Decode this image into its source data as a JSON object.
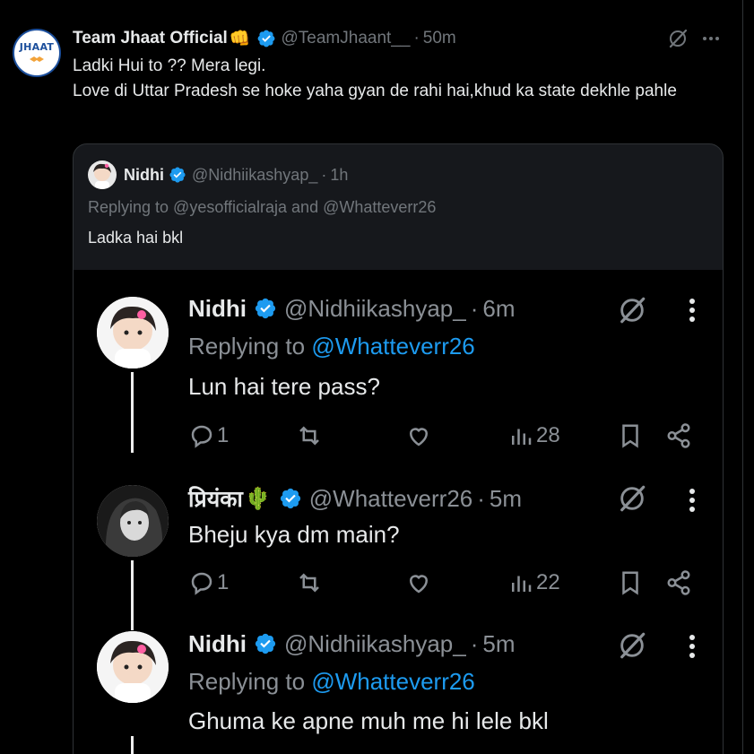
{
  "main": {
    "avatar_text": "JHAAT",
    "name": "Team Jhaat Official",
    "emoji": "👊",
    "handle": "@TeamJhaant__",
    "dot": "·",
    "time": "50m",
    "text_line1": "Ladki Hui to ?? Mera legi.",
    "text_line2": "Love di Uttar Pradesh se hoke yaha gyan de rahi hai,khud ka state dekhle pahle"
  },
  "quote": {
    "name": "Nidhi",
    "handle": "@Nidhiikashyap_",
    "dot": "·",
    "time": "1h",
    "replying": "Replying to @yesofficialraja and @Whatteverr26",
    "text": "Ladka hai bkl"
  },
  "screenshot": {
    "tweets": [
      {
        "name": "Nidhi",
        "handle": "@Nidhiikashyap_",
        "dot": "·",
        "time": "6m",
        "replying_prefix": "Replying to ",
        "replying_mention": "@Whatteverr26",
        "text": "Lun hai tere pass?",
        "replies": "1",
        "views": "28"
      },
      {
        "name": "प्रियंका",
        "emoji": "🌵",
        "handle": "@Whatteverr26",
        "dot": "·",
        "time": "5m",
        "text": "Bheju kya dm main?",
        "replies": "1",
        "views": "22"
      },
      {
        "name": "Nidhi",
        "handle": "@Nidhiikashyap_",
        "dot": "·",
        "time": "5m",
        "replying_prefix": "Replying to ",
        "replying_mention": "@Whatteverr26",
        "text": "Ghuma ke apne muh me hi lele bkl"
      }
    ]
  },
  "colors": {
    "background": "#000000",
    "card": "#16181c",
    "text": "#e7e9ea",
    "muted": "#71767b",
    "accent": "#1d9bf0"
  }
}
